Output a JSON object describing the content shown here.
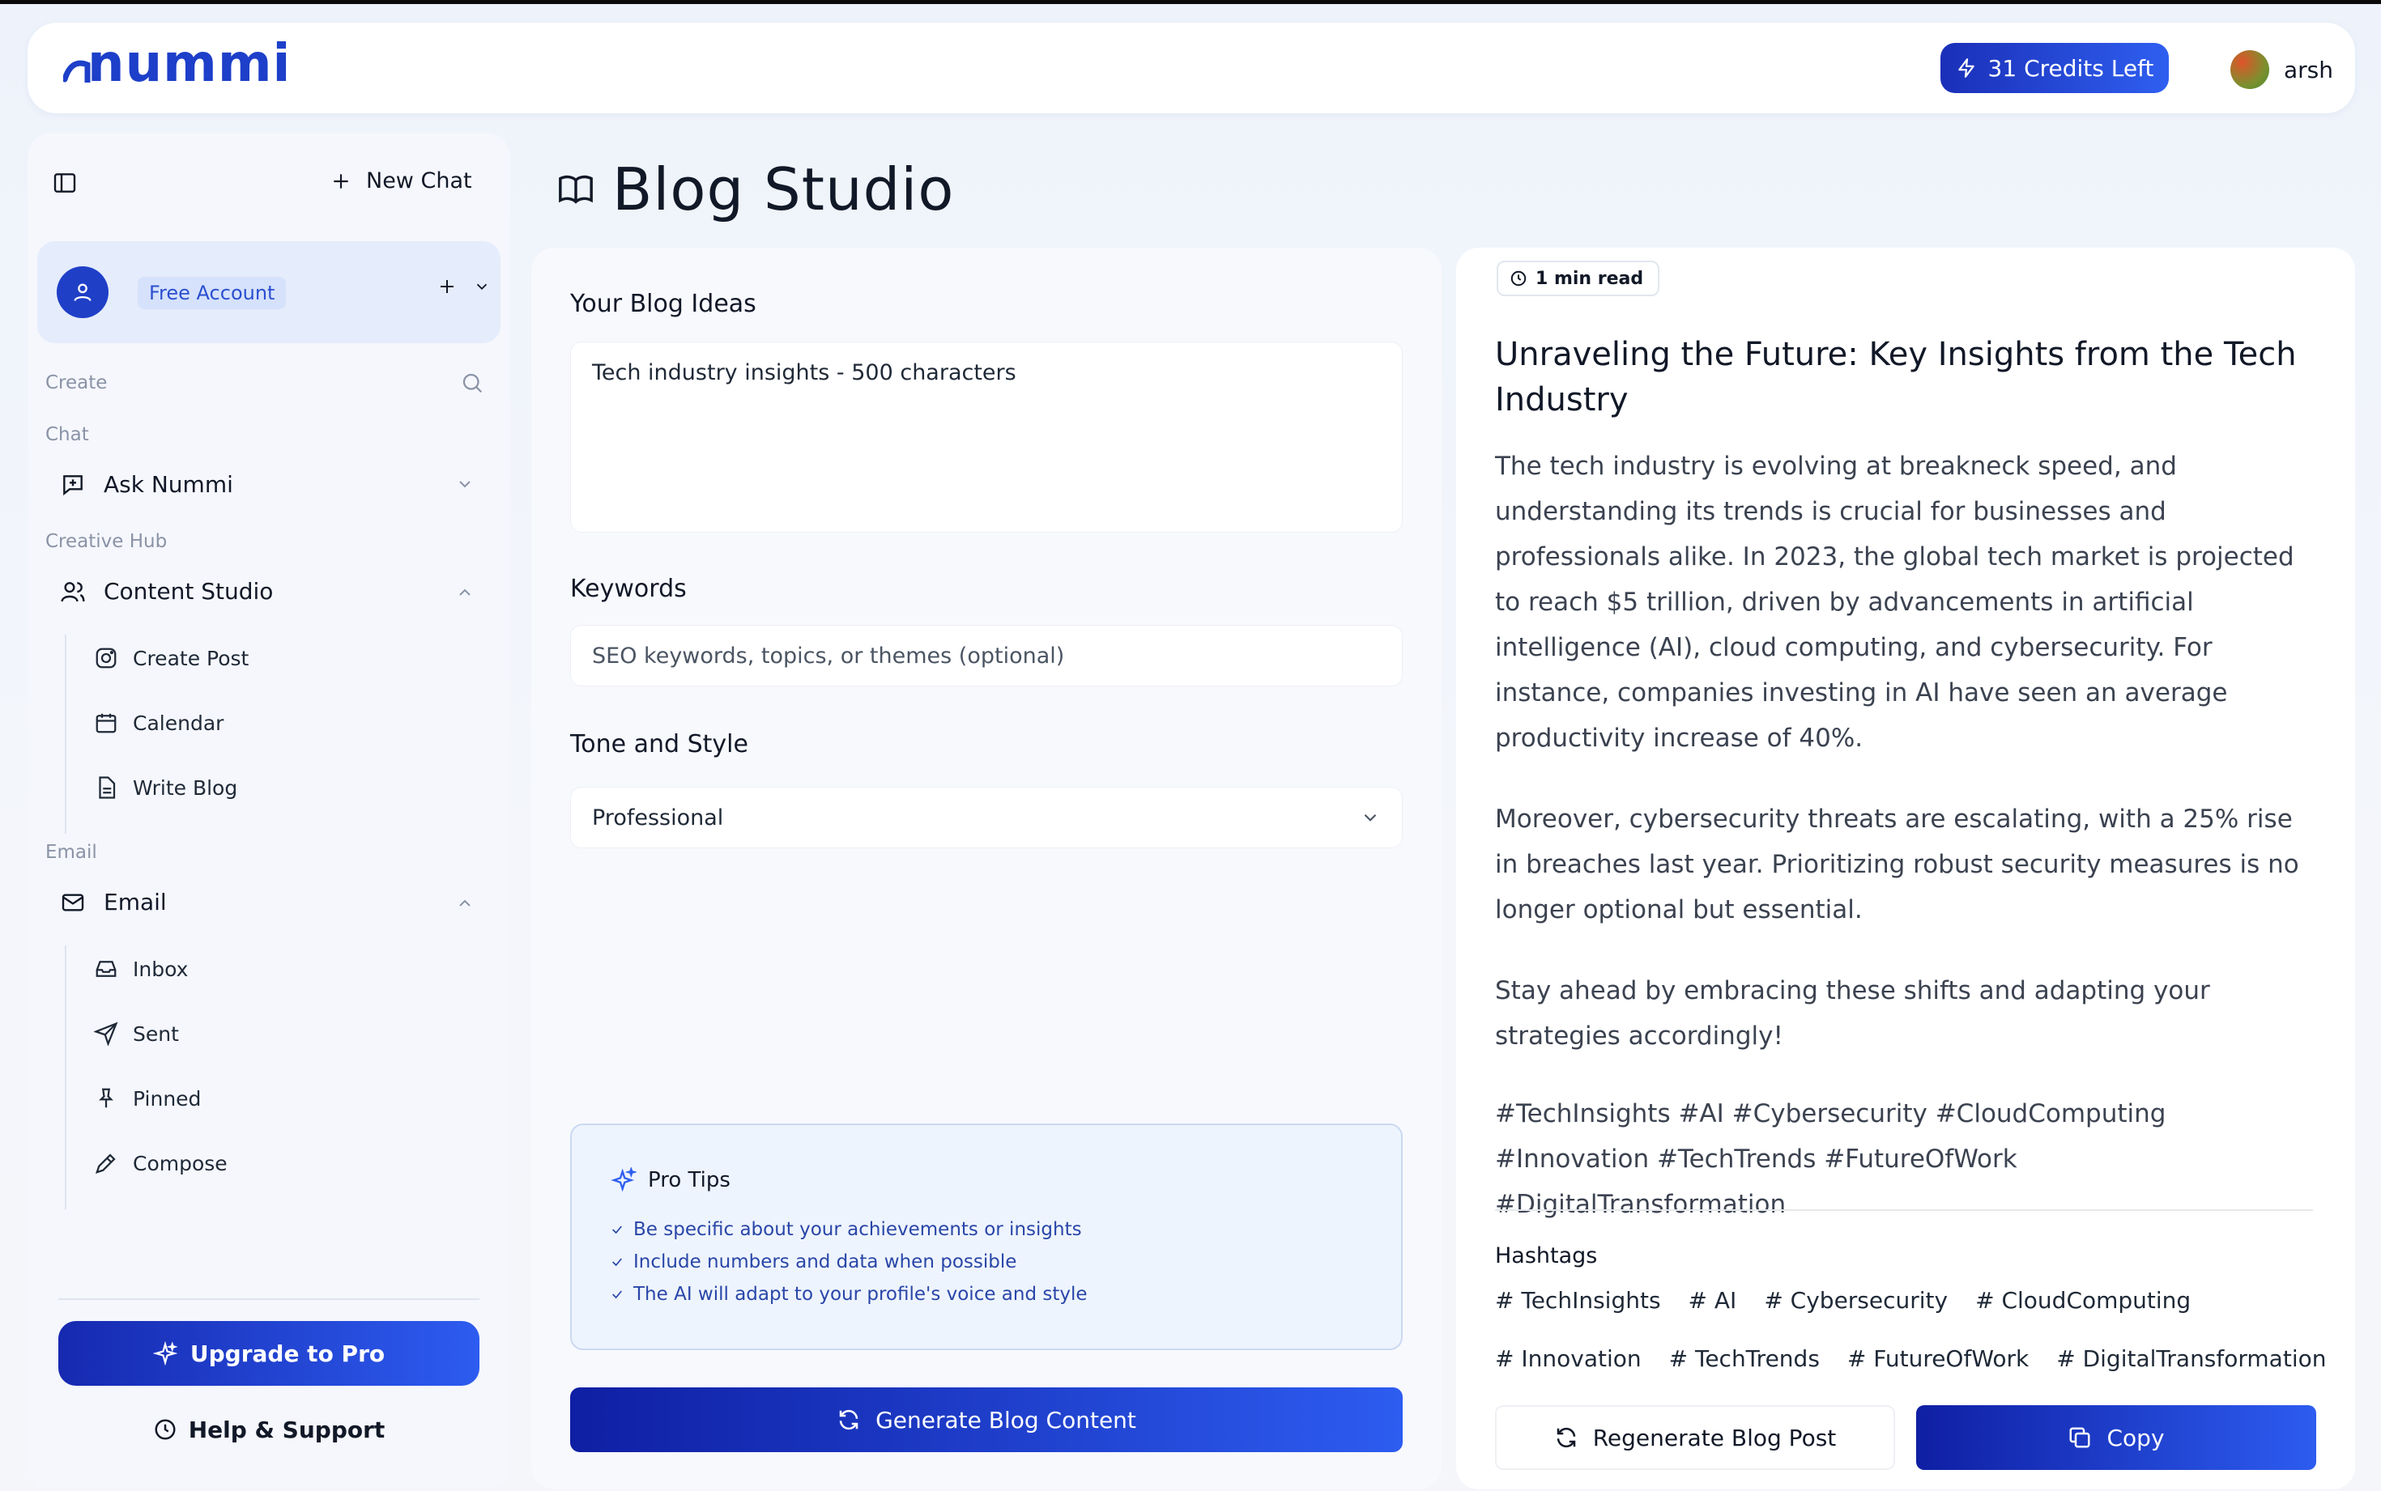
{
  "app": {
    "logo_text": "nummi",
    "credits_label": "31 Credits Left",
    "user_name": "arsh"
  },
  "sidebar": {
    "new_chat": "New Chat",
    "account_badge": "Free Account",
    "sections": {
      "create": "Create",
      "chat": "Chat",
      "creative_hub": "Creative Hub",
      "email": "Email"
    },
    "ask_nummi": "Ask Nummi",
    "content_studio": {
      "label": "Content Studio",
      "items": [
        "Create Post",
        "Calendar",
        "Write Blog"
      ]
    },
    "email_group": {
      "label": "Email",
      "items": [
        "Inbox",
        "Sent",
        "Pinned",
        "Compose"
      ]
    },
    "upgrade": "Upgrade to Pro",
    "help": "Help & Support"
  },
  "page": {
    "title": "Blog Studio"
  },
  "form": {
    "ideas_label": "Your Blog Ideas",
    "ideas_value": "Tech industry insights - 500 characters",
    "keywords_label": "Keywords",
    "keywords_placeholder": "SEO keywords, topics, or themes (optional)",
    "tone_label": "Tone and Style",
    "tone_value": "Professional",
    "tips_title": "Pro Tips",
    "tips": [
      "Be specific about your achievements or insights",
      "Include numbers and data when possible",
      "The AI will adapt to your profile's voice and style"
    ],
    "generate": "Generate Blog Content"
  },
  "output": {
    "read_time": "1 min read",
    "title": "Unraveling the Future: Key Insights from the Tech Industry",
    "paragraphs": [
      "The tech industry is evolving at breakneck speed, and understanding its trends is crucial for businesses and professionals alike. In 2023, the global tech market is projected to reach $5 trillion, driven by advancements in artificial intelligence (AI), cloud computing, and cybersecurity. For instance, companies investing in AI have seen an average productivity increase of 40%.",
      "Moreover, cybersecurity threats are escalating, with a 25% rise in breaches last year. Prioritizing robust security measures is no longer optional but essential.",
      "Stay ahead by embracing these shifts and adapting your strategies accordingly!",
      "#TechInsights #AI #Cybersecurity #CloudComputing #Innovation #TechTrends #FutureOfWork #DigitalTransformation"
    ],
    "hashtags_label": "Hashtags",
    "hashtags": [
      "# TechInsights",
      "# AI",
      "# Cybersecurity",
      "# CloudComputing",
      "# Innovation",
      "# TechTrends",
      "# FutureOfWork",
      "# DigitalTransformation"
    ],
    "regenerate": "Regenerate Blog Post",
    "copy": "Copy"
  },
  "colors": {
    "brand": "#1d3fc9",
    "accent_start": "#1629b0",
    "accent_end": "#2d5cf0",
    "tip_text": "#2946a8"
  }
}
